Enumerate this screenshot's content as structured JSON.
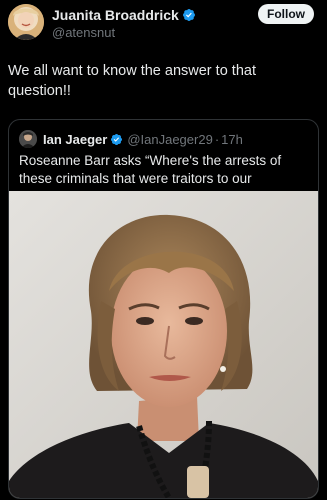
{
  "post": {
    "author": {
      "display_name": "Juanita Broaddrick",
      "handle": "@atensnut",
      "verified_icon": "verified-badge-icon",
      "avatar_icon": "profile-avatar"
    },
    "follow_label": "Follow",
    "text": "We all want to know the answer to that question!!"
  },
  "quote": {
    "author": {
      "display_name": "Ian Jaeger",
      "handle": "@IanJaeger29",
      "separator": "·",
      "time": "17h",
      "verified_icon": "verified-badge-icon"
    },
    "text": "Roseanne Barr asks “Where's the arrests of these criminals that were traitors to our country?”",
    "media_icon": "photo-woman-portrait"
  },
  "colors": {
    "background": "#000000",
    "text_primary": "#e7e9ea",
    "text_secondary": "#71767b",
    "verified_blue": "#1d9bf0",
    "border": "#2f3336",
    "button_bg": "#eff3f4",
    "button_text": "#0f1419"
  }
}
